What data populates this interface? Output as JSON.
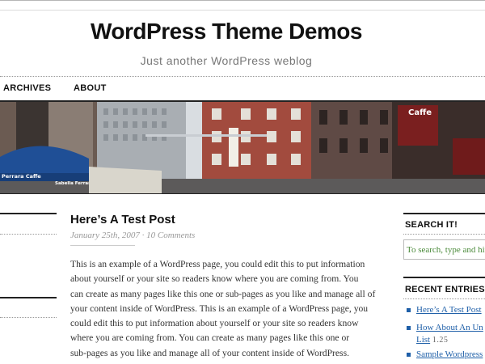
{
  "site": {
    "title": "WordPress Theme Demos",
    "tagline": "Just another WordPress weblog"
  },
  "nav": {
    "items": [
      {
        "label": "ARCHIVES"
      },
      {
        "label": "ABOUT"
      }
    ]
  },
  "header_image": {
    "signs": [
      "Perrara Caffe",
      "Sabella Ferrara Caffe",
      "Caffe"
    ]
  },
  "post": {
    "title": "Here’s A Test Post",
    "date": "January 25th, 2007",
    "separator": "·",
    "comments": "10 Comments",
    "body_lines": [
      "This is an example of a WordPress page, you could edit this to put information",
      "about yourself or your site so readers know where you are coming from. You",
      "can create as many pages like this one or sub-pages as you like and manage all of",
      "your content inside of WordPress. This is an example of a WordPress page, you",
      "could edit this to put information about yourself or your site so readers know",
      "where you are coming from. You can create as many pages like this one or",
      "sub-pages as you like and manage all of your content inside of WordPress."
    ]
  },
  "sidebar": {
    "search": {
      "heading": "SEARCH IT!",
      "placeholder": "To search, type and hit enter"
    },
    "recent": {
      "heading": "RECENT ENTRIES",
      "items": [
        {
          "label": "Here’s A Test Post",
          "count": ""
        },
        {
          "label": "How About An Un",
          "label2": "List",
          "count": "1.25"
        },
        {
          "label": "Sample Wordpress",
          "count": ""
        }
      ]
    }
  },
  "colors": {
    "link": "#1e5fa8",
    "search_text": "#4a8a3a",
    "meta": "#999999"
  }
}
